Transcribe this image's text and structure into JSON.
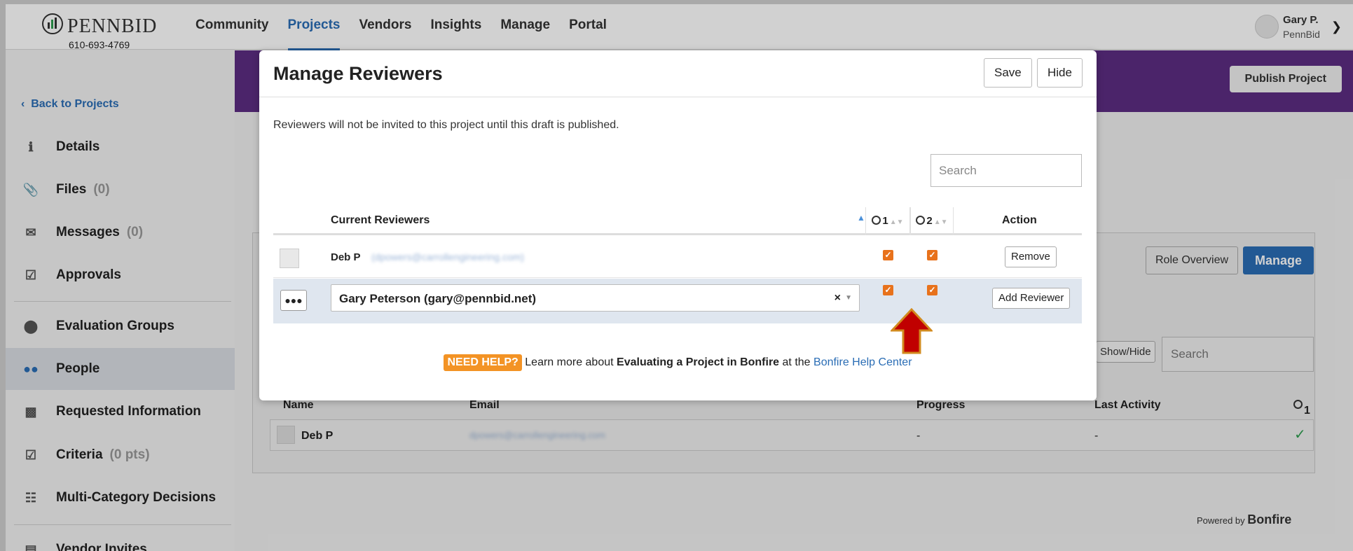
{
  "brand": {
    "name": "PENNBID",
    "phone": "610-693-4769"
  },
  "nav": {
    "items": [
      "Community",
      "Projects",
      "Vendors",
      "Insights",
      "Manage",
      "Portal"
    ],
    "active": "Projects"
  },
  "user": {
    "name": "Gary P.",
    "org": "PennBid"
  },
  "sidebar": {
    "back": "Back to Projects",
    "items": [
      {
        "label": "Details",
        "count": "",
        "icon": "info-icon"
      },
      {
        "label": "Files",
        "count": "(0)",
        "icon": "paperclip-icon"
      },
      {
        "label": "Messages",
        "count": "(0)",
        "icon": "envelope-icon"
      },
      {
        "label": "Approvals",
        "count": "",
        "icon": "checkbox-icon"
      },
      {
        "label": "Evaluation Groups",
        "count": "",
        "icon": "circle-icon"
      },
      {
        "label": "People",
        "count": "",
        "icon": "users-icon"
      },
      {
        "label": "Requested Information",
        "count": "",
        "icon": "inbox-icon"
      },
      {
        "label": "Criteria",
        "count": "(0 pts)",
        "icon": "checkbox-icon"
      },
      {
        "label": "Multi-Category Decisions",
        "count": "",
        "icon": "sitemap-icon"
      },
      {
        "label": "Vendor Invites",
        "count": "",
        "icon": "id-card-icon"
      }
    ]
  },
  "page": {
    "publish": "Publish Project",
    "role_overview": "Role Overview",
    "manage": "Manage",
    "show_hide": "Show/Hide",
    "search_placeholder": "Search",
    "table": {
      "headers": [
        "Name",
        "Email",
        "Progress",
        "Last Activity",
        "1"
      ],
      "row": {
        "name": "Deb P",
        "email": "dpowers@carrollengineering.com",
        "progress": "-",
        "last_activity": "-"
      }
    },
    "powered_by": "Powered by",
    "powered_brand": "Bonfire"
  },
  "modal": {
    "title": "Manage Reviewers",
    "save": "Save",
    "hide": "Hide",
    "notice": "Reviewers will not be invited to this project until this draft is published.",
    "search_placeholder": "Search",
    "col_reviewers": "Current Reviewers",
    "col_g1": "1",
    "col_g2": "2",
    "col_action": "Action",
    "reviewer": {
      "name": "Deb P",
      "email": "(dpowers@carrollengineering.com)",
      "g1": true,
      "g2": true,
      "action": "Remove"
    },
    "new_reviewer": {
      "value": "Gary Peterson (gary@pennbid.net)",
      "g1": true,
      "g2": true,
      "action": "Add Reviewer"
    },
    "help": {
      "badge": "NEED HELP?",
      "text1": "Learn more about",
      "bold": "Evaluating a Project in Bonfire",
      "text2": "at the",
      "link": "Bonfire Help Center"
    }
  },
  "colors": {
    "accent": "#2a6db5",
    "banner": "#5c2d82",
    "checkbox": "#e8721c",
    "help_badge": "#f39325",
    "arrow": "#c00000"
  }
}
